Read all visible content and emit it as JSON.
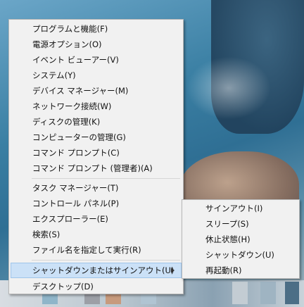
{
  "menu": {
    "items": [
      {
        "label": "プログラムと機能(F)"
      },
      {
        "label": "電源オプション(O)"
      },
      {
        "label": "イベント ビューアー(V)"
      },
      {
        "label": "システム(Y)"
      },
      {
        "label": "デバイス マネージャー(M)"
      },
      {
        "label": "ネットワーク接続(W)"
      },
      {
        "label": "ディスクの管理(K)"
      },
      {
        "label": "コンピューターの管理(G)"
      },
      {
        "label": "コマンド プロンプト(C)"
      },
      {
        "label": "コマンド プロンプト (管理者)(A)"
      },
      {
        "label": "タスク マネージャー(T)"
      },
      {
        "label": "コントロール パネル(P)"
      },
      {
        "label": "エクスプローラー(E)"
      },
      {
        "label": "検索(S)"
      },
      {
        "label": "ファイル名を指定して実行(R)"
      },
      {
        "label": "シャットダウンまたはサインアウト(U)"
      },
      {
        "label": "デスクトップ(D)"
      }
    ]
  },
  "submenu": {
    "items": [
      {
        "label": "サインアウト(I)"
      },
      {
        "label": "スリープ(S)"
      },
      {
        "label": "休止状態(H)"
      },
      {
        "label": "シャットダウン(U)"
      },
      {
        "label": "再起動(R)"
      }
    ]
  },
  "colors": {
    "menu_bg": "#f1f1f1",
    "highlight": "#cbe1f7",
    "highlight_border": "#9ec4ea"
  }
}
